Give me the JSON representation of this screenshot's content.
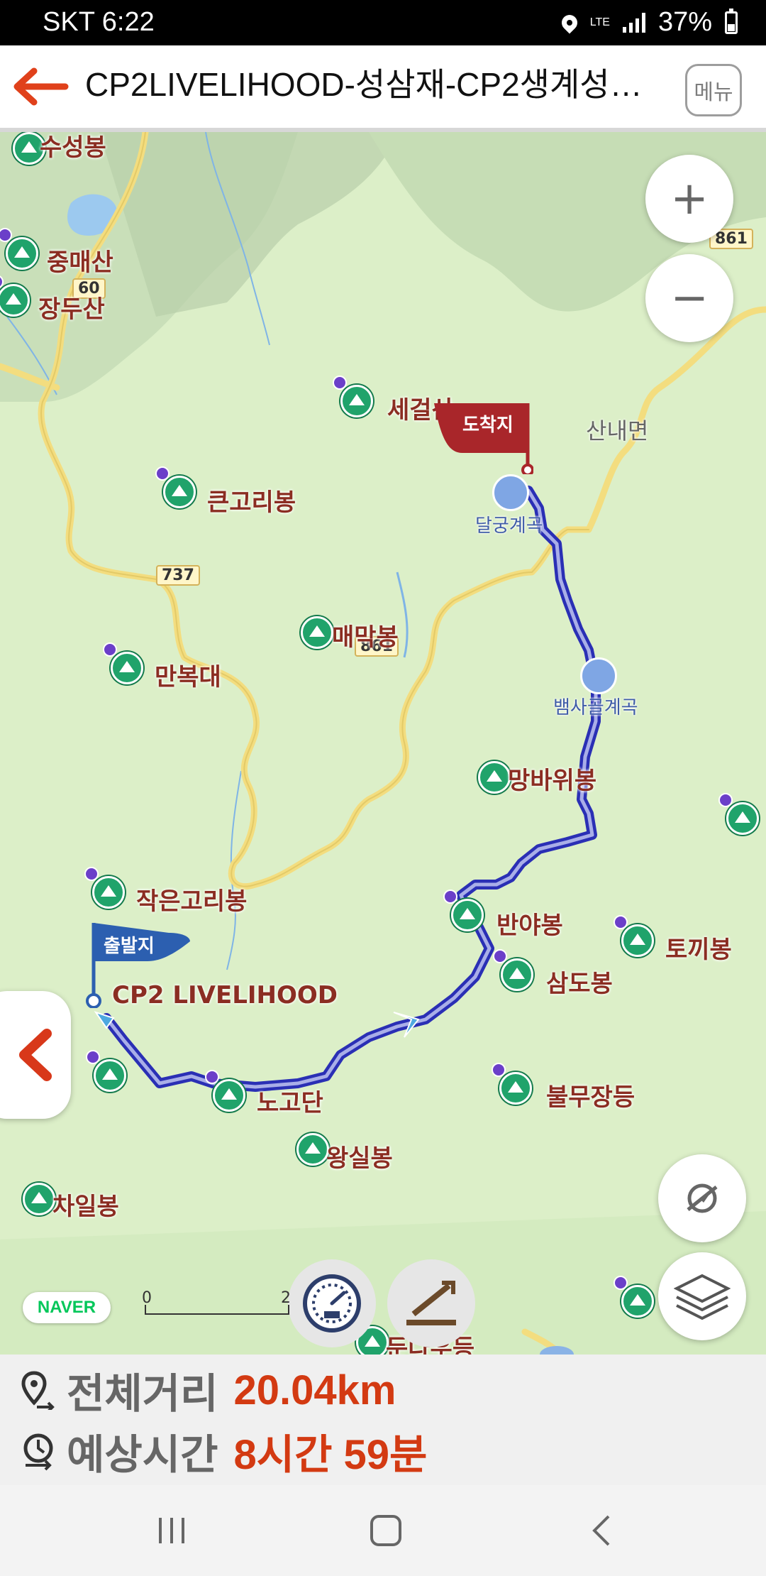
{
  "status_bar": {
    "carrier": "SKT",
    "time": "6:22",
    "network": "LTE",
    "battery": "37%"
  },
  "header": {
    "title": "CP2LIVELIHOOD-성삼재-CP2생계성삼...",
    "menu_label": "메뉴"
  },
  "map": {
    "labels": [
      "수성봉",
      "중매산",
      "장두산",
      "세걸산",
      "산내면",
      "큰고리봉",
      "매막봉",
      "만복대",
      "망바위봉",
      "작은고리봉",
      "반야봉",
      "토끼봉",
      "CP2 LIVELIHOOD",
      "삼도봉",
      "노고단",
      "불무장등",
      "왕실봉",
      "차일봉",
      "둔다우등"
    ],
    "valley_labels": [
      "달궁계곡",
      "뱀사골계곡"
    ],
    "road_numbers": [
      "60",
      "737",
      "861",
      "861"
    ],
    "start_flag": "출발지",
    "end_flag": "도착지",
    "brand": "NAVER",
    "scale_start": "0",
    "scale_end": "2"
  },
  "controls": {
    "zoom_in": "+",
    "zoom_out": "−",
    "location_icon": "location-off-icon",
    "layers_icon": "layers-icon",
    "speedometer_icon": "speedometer-icon",
    "elevation_icon": "elevation-icon"
  },
  "summary": {
    "distance_label": "전체거리",
    "distance_value": "20.04km",
    "time_label": "예상시간",
    "time_value": "8시간 59분"
  },
  "colors": {
    "accent": "#d33a12",
    "route": "#2a2fb5",
    "start_flag": "#2c5fb0",
    "end_flag": "#a9262a"
  }
}
